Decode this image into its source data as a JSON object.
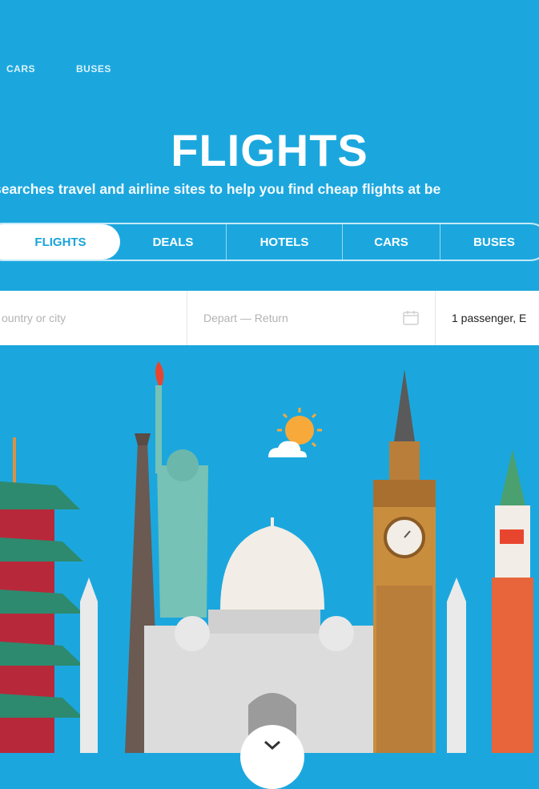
{
  "topnav": {
    "items": [
      "CARS",
      "BUSES"
    ]
  },
  "hero": {
    "title": "FLIGHTS",
    "subtitle": "searches travel and airline sites to help you find cheap flights at be"
  },
  "tabs": [
    {
      "label": "FLIGHTS",
      "active": true
    },
    {
      "label": "DEALS",
      "active": false
    },
    {
      "label": "HOTELS",
      "active": false
    },
    {
      "label": "CARS",
      "active": false
    },
    {
      "label": "BUSES",
      "active": false
    }
  ],
  "search": {
    "destination_placeholder": "ountry or city",
    "dates_placeholder": "Depart — Return",
    "passengers": "1 passenger, E"
  },
  "colors": {
    "sky": "#1ba7de",
    "tab_active_text": "#1aa3d9"
  },
  "icons": [
    "calendar-icon",
    "chevron-down-icon"
  ]
}
